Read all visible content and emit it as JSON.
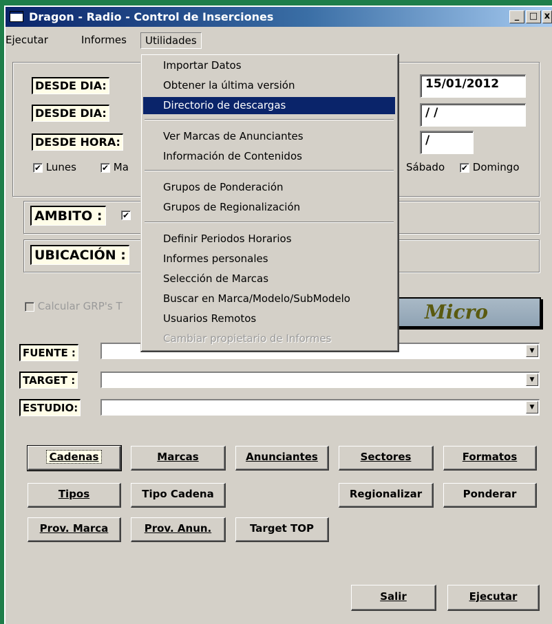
{
  "window": {
    "title": "Dragon - Radio - Control de Inserciones",
    "min_glyph": "_",
    "max_glyph": "□",
    "close_glyph": "x"
  },
  "menubar": {
    "items": [
      "Ejecutar",
      "Informes",
      "Utilidades"
    ]
  },
  "dates": {
    "desde_dia_1_label": "DESDE DIA:",
    "desde_dia_2_label": "DESDE DIA:",
    "desde_hora_label": "DESDE HORA:",
    "hasta_dia_1_value": "15/01/2012",
    "hasta_dia_2_value": "/ /",
    "hasta_hora_value": "/"
  },
  "days": {
    "lunes": "Lunes",
    "martes_partial": "Ma",
    "sabado": "Sábado",
    "domingo": "Domingo"
  },
  "ambito_label": "AMBITO :",
  "ubicacion_label": "UBICACIÓN :",
  "calcular_grps_label": "Calcular GRP's T",
  "micro_text": "Micro",
  "combos": {
    "fuente_label": "FUENTE :",
    "target_label": "TARGET :",
    "estudio_label": "ESTUDIO:"
  },
  "buttons": {
    "row1": [
      {
        "label": "Cadenas",
        "accel": "C"
      },
      {
        "label": "Marcas",
        "accel": "M"
      },
      {
        "label": "Anunciantes",
        "accel": "A"
      },
      {
        "label": "Sectores",
        "accel": "S"
      },
      {
        "label": "Formatos",
        "accel": "F"
      }
    ],
    "row2": [
      {
        "label": "Tipos",
        "accel": "T"
      },
      {
        "label": "Tipo Cadena",
        "accel": ""
      },
      {
        "label": "Regionalizar",
        "accel": ""
      },
      {
        "label": "Ponderar",
        "accel": ""
      }
    ],
    "row3": [
      {
        "label": "Prov. Marca",
        "accel": "P"
      },
      {
        "label": "Prov. Anun.",
        "accel": "P"
      },
      {
        "label": "Target TOP",
        "accel": ""
      }
    ],
    "salir": {
      "label": "Salir",
      "accel": "S"
    },
    "ejecutar": {
      "label": "Ejecutar",
      "accel": "E"
    }
  },
  "utilidades_menu": {
    "items": [
      {
        "label": "Importar Datos",
        "state": "normal"
      },
      {
        "label": "Obtener la última versión",
        "state": "normal"
      },
      {
        "label": "Directorio de descargas",
        "state": "selected"
      },
      {
        "label": "Ver Marcas de Anunciantes",
        "state": "normal"
      },
      {
        "label": "Información de Contenidos",
        "state": "normal"
      },
      {
        "label": "Grupos de Ponderación",
        "state": "normal"
      },
      {
        "label": "Grupos de Regionalización",
        "state": "normal"
      },
      {
        "label": "Definir Periodos Horarios",
        "state": "normal"
      },
      {
        "label": "Informes personales",
        "state": "normal"
      },
      {
        "label": "Selección de Marcas",
        "state": "normal"
      },
      {
        "label": "Buscar en Marca/Modelo/SubModelo",
        "state": "normal"
      },
      {
        "label": "Usuarios Remotos",
        "state": "normal"
      },
      {
        "label": "Cambiar propietario de Informes",
        "state": "disabled"
      }
    ]
  },
  "colors": {
    "title_gradient_start": "#0a246a",
    "menu_highlight": "#0a246a",
    "desktop": "#1e7e4a",
    "face": "#d4d0c8"
  }
}
